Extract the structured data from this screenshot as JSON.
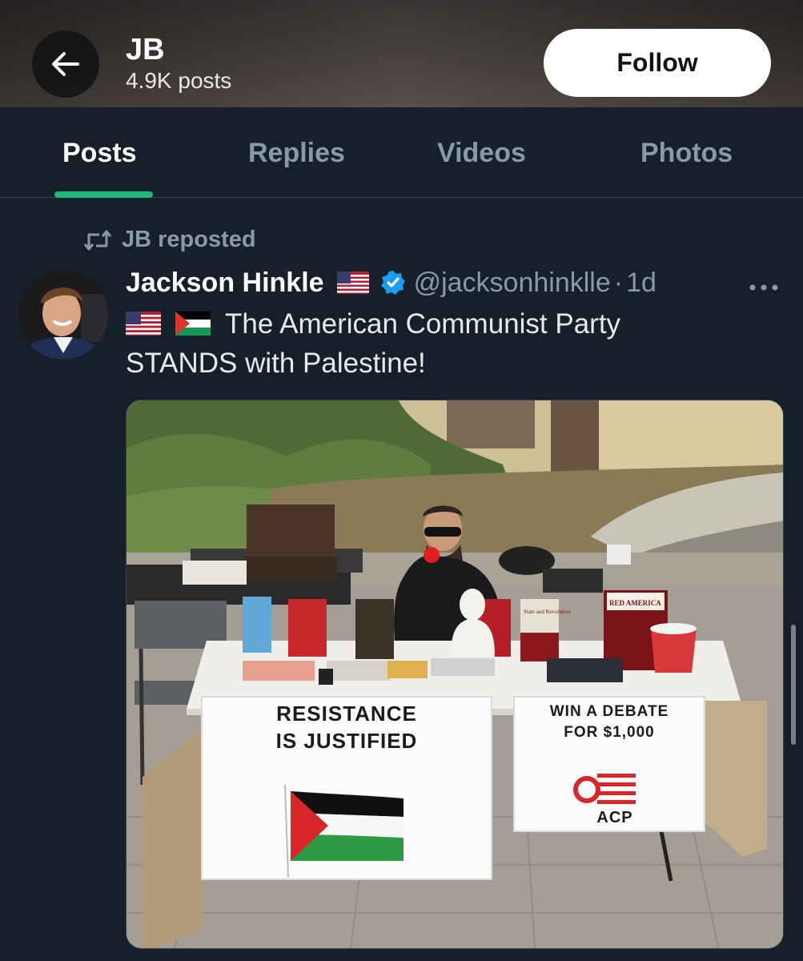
{
  "header": {
    "back_icon": "arrow-left-icon",
    "name": "JB",
    "posts_count": "4.9K posts",
    "follow_label": "Follow"
  },
  "tabs": [
    {
      "label": "Posts",
      "active": true
    },
    {
      "label": "Replies",
      "active": false
    },
    {
      "label": "Videos",
      "active": false
    },
    {
      "label": "Photos",
      "active": false
    }
  ],
  "post": {
    "repost_label": "JB reposted",
    "repost_icon": "repost-icon",
    "author_name": "Jackson Hinkle",
    "author_handle": "@jacksonhinklle",
    "separator": "·",
    "time": "1d",
    "more_icon": "more-horizontal-icon",
    "text_line1": "The American Communist Party",
    "text_line2": "STANDS with Palestine!",
    "photo": {
      "sign_left_line1": "RESISTANCE",
      "sign_left_line2": "IS JUSTIFIED",
      "sign_right_line1": "WIN A DEBATE",
      "sign_right_line2": "FOR $1,000",
      "sign_right_logo": "ACP",
      "book_label": "RED AMERICA",
      "book_label2": "State and Revolution"
    }
  },
  "colors": {
    "background": "#15202b",
    "tab_indicator": "#1fb77a",
    "verified": "#1d9bf0",
    "muted_text": "#8b98a5"
  }
}
